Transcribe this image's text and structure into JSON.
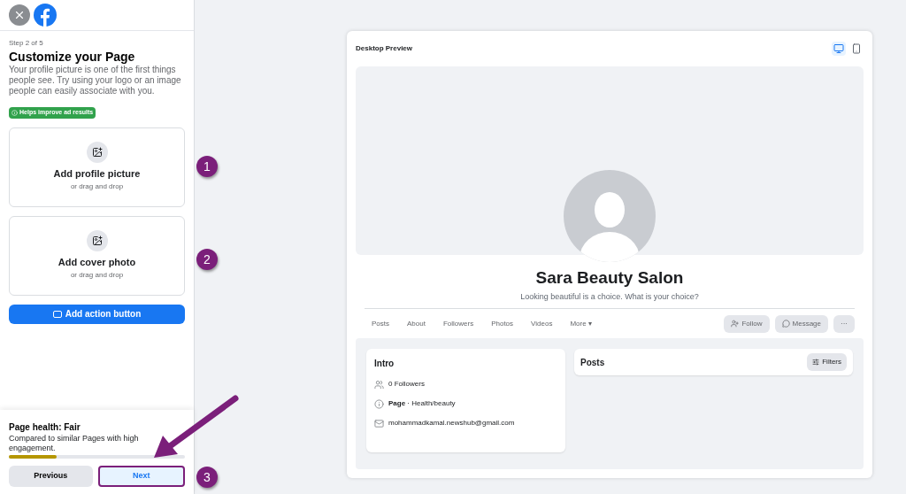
{
  "sidebar": {
    "step": "Step 2 of 5",
    "title": "Customize your Page",
    "description": "Your profile picture is one of the first things people see. Try using your logo or an image people can easily associate with you.",
    "badge": "Helps improve ad results",
    "upload_cards": [
      {
        "title": "Add profile picture",
        "hint": "or drag and drop"
      },
      {
        "title": "Add cover photo",
        "hint": "or drag and drop"
      }
    ],
    "action_button": "Add action button",
    "health": {
      "title": "Page health: Fair",
      "description": "Compared to similar Pages with high engagement.",
      "level": 0.27
    },
    "buttons": [
      {
        "label": "Previous",
        "kind": "secondary"
      },
      {
        "label": "Next",
        "kind": "primary"
      }
    ]
  },
  "preview": {
    "title": "Desktop Preview",
    "devices": [
      {
        "kind": "desktop",
        "selected": true
      },
      {
        "kind": "mobile",
        "selected": false
      }
    ],
    "page_name": "Sara Beauty Salon",
    "tagline": "Looking beautiful is a choice. What is your choice?",
    "tabs": [
      {
        "label": "Posts"
      },
      {
        "label": "About"
      },
      {
        "label": "Followers"
      },
      {
        "label": "Photos"
      },
      {
        "label": "Videos"
      },
      {
        "label": "More ▾"
      }
    ],
    "actions": [
      {
        "label": "Follow",
        "kind": "follow",
        "disabled": true
      },
      {
        "label": "Message",
        "kind": "message",
        "disabled": true
      },
      {
        "label": "···",
        "kind": "more",
        "disabled": true
      }
    ],
    "intro": {
      "title": "Intro",
      "items": [
        {
          "kind": "followers",
          "text": "0 Followers"
        },
        {
          "kind": "category",
          "text": "**Page** · Health/beauty"
        },
        {
          "kind": "email",
          "text": "mohammadkamal.newshub@gmail.com"
        }
      ]
    },
    "posts": {
      "title": "Posts",
      "filter": "Filters"
    }
  },
  "annotations": [
    {
      "label": "1"
    },
    {
      "label": "2"
    },
    {
      "label": "3"
    }
  ]
}
